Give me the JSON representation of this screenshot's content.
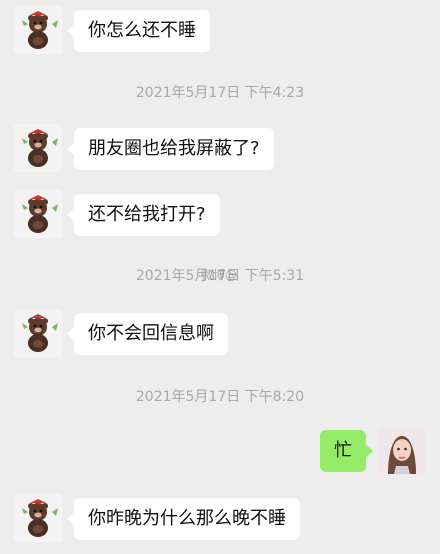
{
  "conversation": {
    "messages": [
      {
        "side": "incoming",
        "text": "你怎么还不睡"
      },
      {
        "side": "incoming",
        "text": "朋友圈也给我屏蔽了?"
      },
      {
        "side": "incoming",
        "text": "还不给我打开?"
      },
      {
        "side": "incoming",
        "text": "你不会回信息啊"
      },
      {
        "side": "outgoing",
        "text": "忙"
      },
      {
        "side": "incoming",
        "text": "你昨晚为什么那么晚不睡"
      }
    ],
    "timestamps": [
      "2021年5月17日 下午4:23",
      "2021年5月17日 下午5:31",
      "2021年5月17日 下午8:20"
    ]
  },
  "watermark": {
    "text": "微博@"
  },
  "colors": {
    "background": "#ededed",
    "incoming_bubble": "#ffffff",
    "outgoing_bubble": "#95ec69",
    "timestamp_text": "#a9a9a9"
  }
}
